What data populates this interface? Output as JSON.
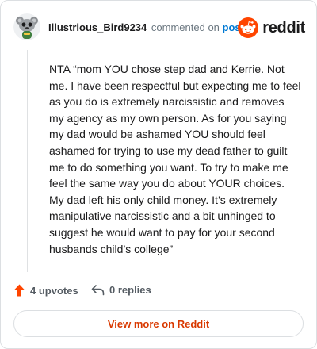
{
  "header": {
    "username": "Illustrious_Bird9234",
    "action_text": "commented on",
    "post_link": "post",
    "logo_text": "reddit"
  },
  "comment": {
    "body": "NTA “mom YOU chose step dad and Kerrie. Not me. I have been respectful but expecting me to feel as you do is extremely narcissistic and removes my agency as my own person. As for you saying my dad would be ashamed YOU should feel ashamed for trying to use my dead father to guilt me to do something you want. To try to make me feel the same way you do about YOUR choices. My dad left his only child money. It’s extremely manipulative narcissistic and a bit unhinged to suggest he would want to pay for your second husbands child’s college”"
  },
  "footer": {
    "upvotes": "4 upvotes",
    "replies": "0 replies",
    "cta": "View more on Reddit"
  },
  "colors": {
    "brand": "#ff4500",
    "link": "#0079d3",
    "cta": "#d93900"
  },
  "icons": {
    "avatar": "snoo-avatar-icon",
    "logo": "reddit-logo-icon",
    "upvote": "upvote-arrow-icon",
    "reply": "reply-arrow-icon"
  }
}
